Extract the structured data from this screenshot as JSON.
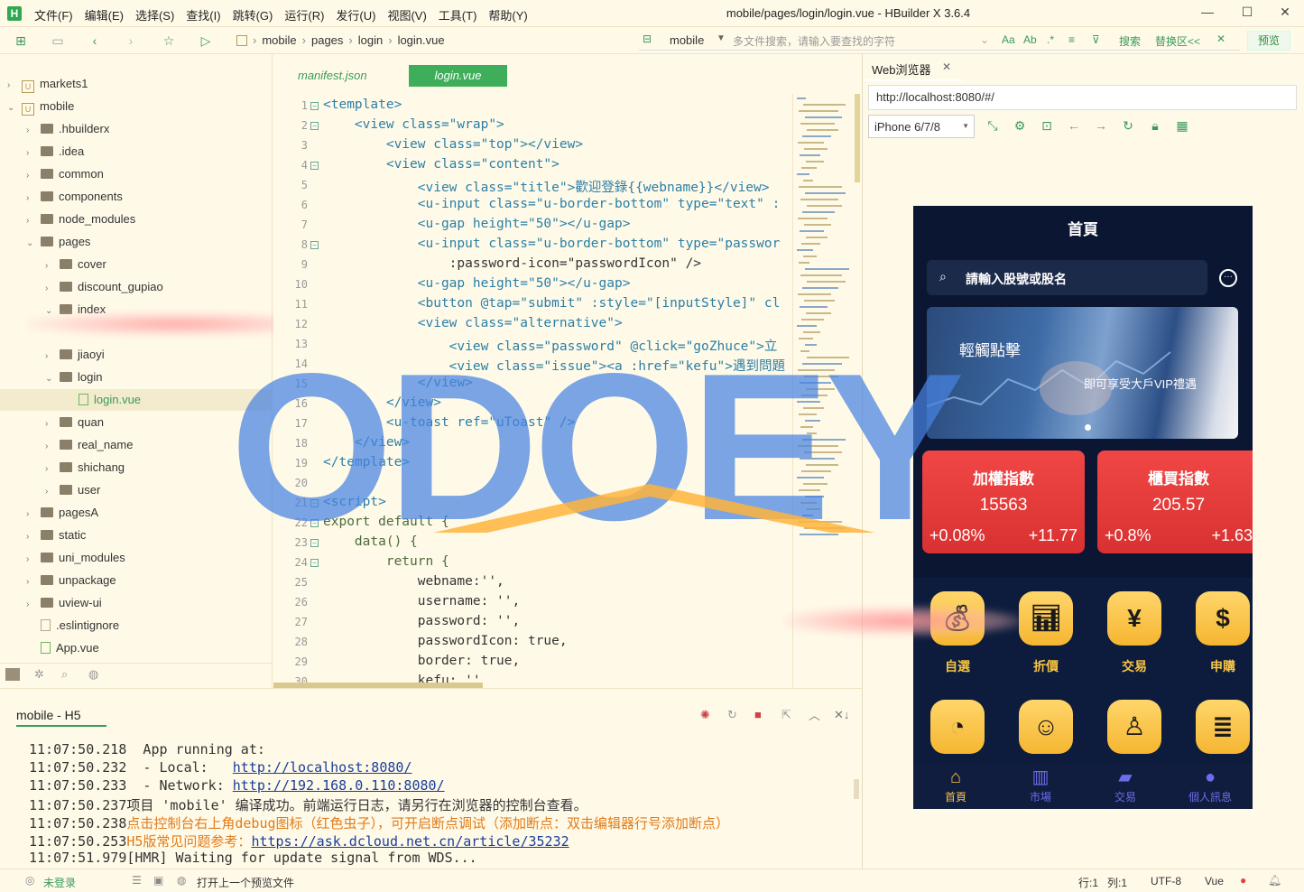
{
  "menu": [
    "文件(F)",
    "编辑(E)",
    "选择(S)",
    "查找(I)",
    "跳转(G)",
    "运行(R)",
    "发行(U)",
    "视图(V)",
    "工具(T)",
    "帮助(Y)"
  ],
  "window_title": "mobile/pages/login/login.vue - HBuilder X 3.6.4",
  "breadcrumb": [
    "mobile",
    "pages",
    "login",
    "login.vue"
  ],
  "search": {
    "scope": "mobile",
    "placeholder": "多文件搜索，请输入要查找的字符",
    "search_label": "搜索",
    "replace_label": "替换区<<"
  },
  "preview_label": "预览",
  "sidebar": {
    "items": [
      {
        "label": "markets1",
        "level": 0,
        "type": "project",
        "expanded": false
      },
      {
        "label": "mobile",
        "level": 0,
        "type": "project",
        "expanded": true
      },
      {
        "label": ".hbuilderx",
        "level": 1,
        "type": "folder"
      },
      {
        "label": ".idea",
        "level": 1,
        "type": "folder"
      },
      {
        "label": "common",
        "level": 1,
        "type": "folder"
      },
      {
        "label": "components",
        "level": 1,
        "type": "folder"
      },
      {
        "label": "node_modules",
        "level": 1,
        "type": "folder"
      },
      {
        "label": "pages",
        "level": 1,
        "type": "folder",
        "expanded": true
      },
      {
        "label": "cover",
        "level": 2,
        "type": "folder"
      },
      {
        "label": "discount_gupiao",
        "level": 2,
        "type": "folder"
      },
      {
        "label": "index",
        "level": 2,
        "type": "folder",
        "expanded": true
      },
      {
        "label": "jiaoyi",
        "level": 2,
        "type": "folder"
      },
      {
        "label": "login",
        "level": 2,
        "type": "folder",
        "expanded": true
      },
      {
        "label": "login.vue",
        "level": 3,
        "type": "vue",
        "selected": true
      },
      {
        "label": "quan",
        "level": 2,
        "type": "folder"
      },
      {
        "label": "real_name",
        "level": 2,
        "type": "folder"
      },
      {
        "label": "shichang",
        "level": 2,
        "type": "folder"
      },
      {
        "label": "user",
        "level": 2,
        "type": "folder"
      },
      {
        "label": "pagesA",
        "level": 1,
        "type": "folder"
      },
      {
        "label": "static",
        "level": 1,
        "type": "folder"
      },
      {
        "label": "uni_modules",
        "level": 1,
        "type": "folder"
      },
      {
        "label": "unpackage",
        "level": 1,
        "type": "folder"
      },
      {
        "label": "uview-ui",
        "level": 1,
        "type": "folder"
      },
      {
        "label": ".eslintignore",
        "level": 1,
        "type": "file"
      },
      {
        "label": "App.vue",
        "level": 1,
        "type": "vue"
      }
    ]
  },
  "editor_tabs": [
    "manifest.json",
    "login.vue"
  ],
  "code_lines": [
    "<template>",
    "    <view class=\"wrap\">",
    "        <view class=\"top\"></view>",
    "        <view class=\"content\">",
    "            <view class=\"title\">歡迎登錄{{webname}}</view>",
    "            <u-input class=\"u-border-bottom\" type=\"text\" :",
    "            <u-gap height=\"50\"></u-gap>",
    "            <u-input class=\"u-border-bottom\" type=\"passwor",
    "                :password-icon=\"passwordIcon\" />",
    "            <u-gap height=\"50\"></u-gap>",
    "            <button @tap=\"submit\" :style=\"[inputStyle]\" cl",
    "            <view class=\"alternative\">",
    "                <view class=\"password\" @click=\"goZhuce\">立",
    "                <view class=\"issue\"><a :href=\"kefu\">遇到問題",
    "            </view>",
    "        </view>",
    "        <u-toast ref=\"uToast\" />",
    "    </view>",
    "</template>",
    "",
    "<script>",
    "export default {",
    "    data() {",
    "        return {",
    "            webname:'',",
    "            username: '',",
    "            password: '',",
    "            passwordIcon: true,",
    "            border: true,",
    "            kefu: ''"
  ],
  "console": {
    "tab_label": "mobile - H5",
    "lines": [
      {
        "time": "11:07:50.218",
        "text": "  App running at:",
        "color": "#333"
      },
      {
        "time": "11:07:50.232",
        "text": "  - Local:   ",
        "link": "http://localhost:8080/",
        "color": "#333"
      },
      {
        "time": "11:07:50.233",
        "text": "  - Network: ",
        "link": "http://192.168.0.110:8080/",
        "color": "#333"
      },
      {
        "time": "11:07:50.237",
        "text": "项目 'mobile' 编译成功。前端运行日志，请另行在浏览器的控制台查看。",
        "color": "#333"
      },
      {
        "time": "11:07:50.238",
        "text": "点击控制台右上角debug图标（红色虫子），可开启断点调试（添加断点：双击编辑器行号添加断点）",
        "color": "#e07b1a"
      },
      {
        "time": "11:07:50.253",
        "text": "H5版常见问题参考：",
        "link": "https://ask.dcloud.net.cn/article/35232",
        "color": "#e07b1a"
      },
      {
        "time": "11:07:51.979",
        "text": "[HMR] Waiting for update signal from WDS...",
        "color": "#333"
      }
    ]
  },
  "browser": {
    "tab_label": "Web浏览器",
    "url": "http://localhost:8080/#/",
    "device": "iPhone 6/7/8"
  },
  "phone": {
    "title": "首頁",
    "search_placeholder": "請輸入股號或股名",
    "banner_text_left": "輕觸點擊",
    "banner_text_right": "即可享受大戶VIP禮遇",
    "cards": [
      {
        "name": "加權指數",
        "value": "15563",
        "pct": "+0.08%",
        "chg": "+11.77"
      },
      {
        "name": "櫃買指數",
        "value": "205.57",
        "pct": "+0.8%",
        "chg": "+1.63"
      }
    ],
    "grid": [
      {
        "label": "自選",
        "icon": "money-bag-icon"
      },
      {
        "label": "折價",
        "icon": "chart-bars-icon"
      },
      {
        "label": "交易",
        "icon": "yen-coin-icon"
      },
      {
        "label": "申購",
        "icon": "piggy-bank-icon"
      },
      {
        "label": "",
        "icon": "pie-chart-icon"
      },
      {
        "label": "",
        "icon": "support-agent-icon"
      },
      {
        "label": "",
        "icon": "user-icon"
      },
      {
        "label": "",
        "icon": "news-icon"
      }
    ],
    "tabbar": [
      {
        "label": "首頁",
        "icon": "home-icon",
        "active": true
      },
      {
        "label": "市場",
        "icon": "market-icon",
        "active": false
      },
      {
        "label": "交易",
        "icon": "wallet-icon",
        "active": false
      },
      {
        "label": "個人訊息",
        "icon": "person-icon",
        "active": false
      }
    ]
  },
  "status": {
    "login": "未登录",
    "open_prev": "打开上一个预览文件",
    "row": "行:1",
    "col": "列:1",
    "encoding": "UTF-8",
    "lang": "Vue"
  },
  "watermark": "ODOEY"
}
